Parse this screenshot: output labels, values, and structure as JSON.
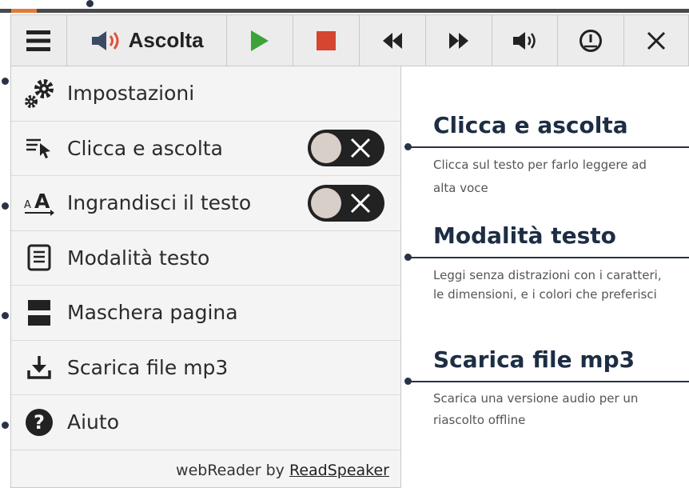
{
  "toolbar": {
    "menu_icon": "hamburger-icon",
    "listen_label": "Ascolta",
    "listen_icon": "speaker-icon",
    "buttons": [
      "play-icon",
      "stop-icon",
      "rewind-icon",
      "fast-forward-icon",
      "volume-icon",
      "speed-gauge-icon",
      "close-icon"
    ]
  },
  "menu": {
    "items": [
      {
        "label": "Impostazioni",
        "icon": "settings-gears-icon"
      },
      {
        "label": "Clicca e ascolta",
        "icon": "click-pointer-icon",
        "toggle": "off"
      },
      {
        "label": "Ingrandisci il testo",
        "icon": "text-enlarge-icon",
        "toggle": "off"
      },
      {
        "label": "Modalità testo",
        "icon": "text-mode-icon"
      },
      {
        "label": "Maschera pagina",
        "icon": "page-mask-icon"
      },
      {
        "label": "Scarica file mp3",
        "icon": "download-icon"
      },
      {
        "label": "Aiuto",
        "icon": "help-icon"
      }
    ],
    "footer_prefix": "webReader by ",
    "footer_link": "ReadSpeaker"
  },
  "callouts": [
    {
      "title": "Clicca e ascolta",
      "desc_line1": "Clicca sul testo per farlo leggere ad",
      "desc_line2": "alta voce"
    },
    {
      "title": "Modalità testo",
      "desc_line1": "Leggi senza distrazioni con i caratteri,",
      "desc_line2": "le dimensioni, e i colori che preferisci"
    },
    {
      "title": "Scarica file mp3",
      "desc_line1": "Scarica una versione audio per un",
      "desc_line2": "riascolto offline"
    }
  ],
  "colors": {
    "accent_dark": "#2a3345",
    "play": "#3aa33a",
    "stop": "#d6452f",
    "title": "#1d2d44"
  }
}
